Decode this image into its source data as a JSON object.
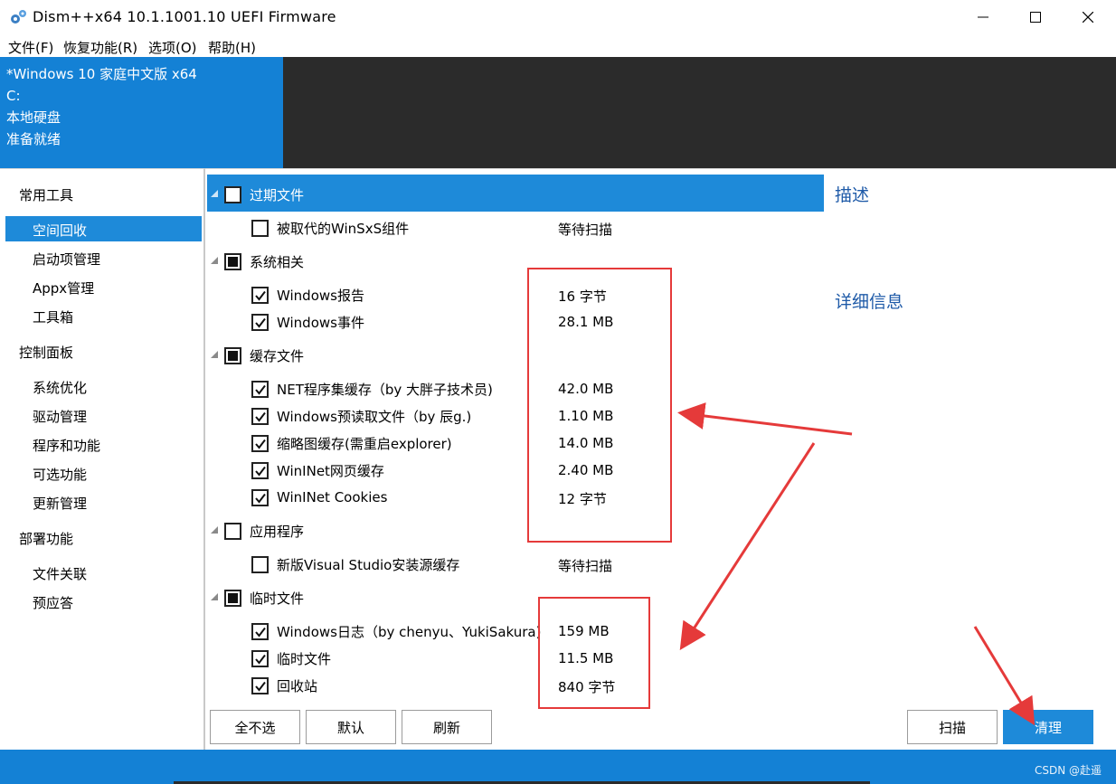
{
  "window": {
    "title": "Dism++x64 10.1.1001.10 UEFI Firmware"
  },
  "menu": [
    "文件(F)",
    "恢复功能(R)",
    "选项(O)",
    "帮助(H)"
  ],
  "info": {
    "os": "*Windows 10 家庭中文版 x64",
    "drive": "C:",
    "disk_type": "本地硬盘",
    "status": "准备就绪"
  },
  "sidebar": {
    "groups": [
      {
        "label": "常用工具",
        "items": [
          "空间回收",
          "启动项管理",
          "Appx管理",
          "工具箱"
        ]
      },
      {
        "label": "控制面板",
        "items": [
          "系统优化",
          "驱动管理",
          "程序和功能",
          "可选功能",
          "更新管理"
        ]
      },
      {
        "label": "部署功能",
        "items": [
          "文件关联",
          "预应答"
        ]
      }
    ],
    "active": "空间回收"
  },
  "cleanup": {
    "groups": [
      {
        "label": "过期文件",
        "state": "unchecked",
        "items": [
          {
            "label": "被取代的WinSxS组件",
            "checked": false,
            "value": "等待扫描"
          }
        ]
      },
      {
        "label": "系统相关",
        "state": "partial",
        "items": [
          {
            "label": "Windows报告",
            "checked": true,
            "value": "16 字节"
          },
          {
            "label": "Windows事件",
            "checked": true,
            "value": "28.1 MB"
          }
        ]
      },
      {
        "label": "缓存文件",
        "state": "partial",
        "items": [
          {
            "label": "NET程序集缓存（by 大胖子技术员)",
            "checked": true,
            "value": "42.0 MB"
          },
          {
            "label": "Windows预读取文件（by 辰g.)",
            "checked": true,
            "value": "1.10 MB"
          },
          {
            "label": "缩略图缓存(需重启explorer)",
            "checked": true,
            "value": "14.0 MB"
          },
          {
            "label": "WinINet网页缓存",
            "checked": true,
            "value": "2.40 MB"
          },
          {
            "label": "WinINet Cookies",
            "checked": true,
            "value": "12 字节"
          }
        ]
      },
      {
        "label": "应用程序",
        "state": "unchecked",
        "items": [
          {
            "label": "新版Visual Studio安装源缓存",
            "checked": false,
            "value": "等待扫描"
          }
        ]
      },
      {
        "label": "临时文件",
        "state": "partial",
        "items": [
          {
            "label": "Windows日志（by chenyu、YukiSakura)",
            "checked": true,
            "value": "159 MB"
          },
          {
            "label": "临时文件",
            "checked": true,
            "value": "11.5 MB"
          },
          {
            "label": "回收站",
            "checked": true,
            "value": "840 字节"
          }
        ]
      }
    ]
  },
  "panel": {
    "description_title": "描述",
    "details_title": "详细信息"
  },
  "buttons": {
    "deselect_all": "全不选",
    "default": "默认",
    "refresh": "刷新",
    "scan": "扫描",
    "clean": "清理"
  },
  "watermark": "CSDN @赴遥",
  "colors": {
    "accent": "#1e8ad9",
    "header_blue": "#1481d5",
    "header_dark": "#2b2b2b",
    "annotation_red": "#e53a3a"
  }
}
